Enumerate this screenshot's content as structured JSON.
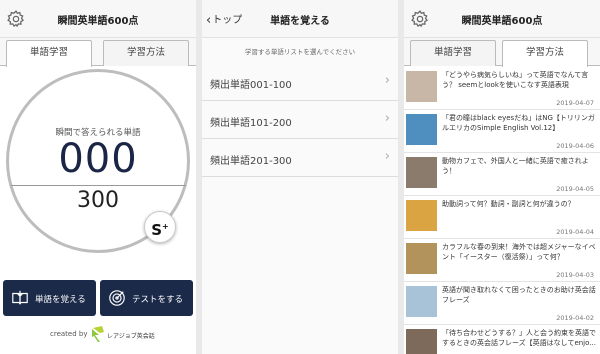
{
  "app": {
    "title": "瞬間英単語600点"
  },
  "tabs": {
    "study": "単語学習",
    "method": "学習方法"
  },
  "study": {
    "caption": "瞬間で答えられる単語",
    "count": "000",
    "total": "300",
    "badge": "S",
    "badge_plus": "+",
    "memorize_button": "単語を覚える",
    "test_button": "テストをする",
    "credit": "created by",
    "logo_text": "レアジョブ英会話"
  },
  "wordlist": {
    "back_label": "トップ",
    "title": "単語を覚える",
    "hint": "学習する単語リストを選んでください",
    "items": [
      {
        "label": "頻出単語001-100"
      },
      {
        "label": "頻出単語101-200"
      },
      {
        "label": "頻出単語201-300"
      }
    ]
  },
  "articles": [
    {
      "title": "「どうやら病気らしいね」って英語でなんて言う？ seemとlookを使いこなす英語表現",
      "date": "2019-04-07",
      "thumb_color": "#c8b7a6"
    },
    {
      "title": "「君の瞳はblack eyesだね」はNG【トリリンガルエリカのSimple English Vol.12】",
      "date": "2019-04-06",
      "thumb_color": "#4f8fbf"
    },
    {
      "title": "動物カフェで、外国人と一緒に英語で癒されよう！",
      "date": "2019-04-05",
      "thumb_color": "#8a7b6d"
    },
    {
      "title": "助動詞って何？動詞・副詞と何が違うの？",
      "date": "2019-04-04",
      "thumb_color": "#d9a441"
    },
    {
      "title": "カラフルな春の到来！海外では超メジャーなイベント「イースター（復活祭）」って何？",
      "date": "2019-04-03",
      "thumb_color": "#b3935c"
    },
    {
      "title": "英語が聞き取れなくて困ったときのお助け英会話フレーズ",
      "date": "2019-04-02",
      "thumb_color": "#a8c2d8"
    },
    {
      "title": "「待ち合わせどうする？」人と会う約束を英語でするときの英会話フレーズ【英語はなしてenjo...",
      "date": "",
      "thumb_color": "#7d6a5b"
    }
  ],
  "colors": {
    "navy": "#1c2a4a",
    "ring": "#bdbdbd"
  },
  "icons": [
    "gear-icon",
    "chevron-left-icon",
    "chevron-right-icon",
    "book-icon",
    "target-icon"
  ]
}
